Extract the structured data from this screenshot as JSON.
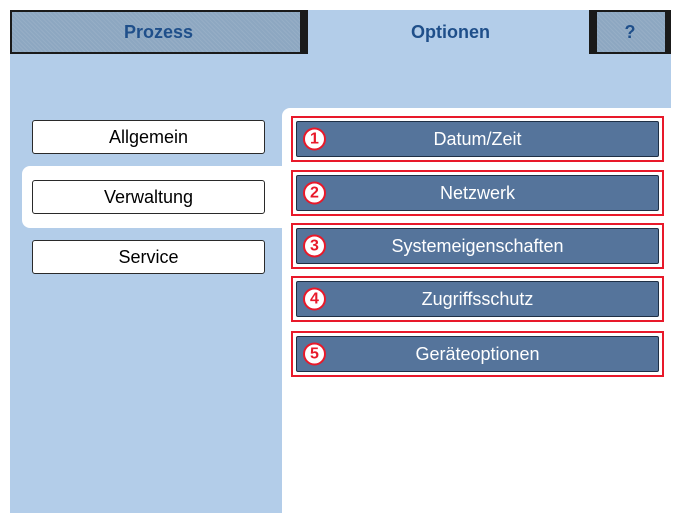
{
  "tabs": [
    {
      "label": "Prozess"
    },
    {
      "label": "Optionen"
    },
    {
      "label": "?"
    }
  ],
  "sidebar": {
    "items": [
      {
        "label": "Allgemein"
      },
      {
        "label": "Verwaltung"
      },
      {
        "label": "Service"
      }
    ]
  },
  "options": [
    {
      "number": "1",
      "label": "Datum/Zeit"
    },
    {
      "number": "2",
      "label": "Netzwerk"
    },
    {
      "number": "3",
      "label": "Systemeigenschaften"
    },
    {
      "number": "4",
      "label": "Zugriffsschutz"
    },
    {
      "number": "5",
      "label": "Geräteoptionen"
    }
  ],
  "colors": {
    "background": "#b3cde9",
    "option_button": "#55749b",
    "highlight": "#e8192a",
    "tab_text": "#1f4f8a"
  }
}
